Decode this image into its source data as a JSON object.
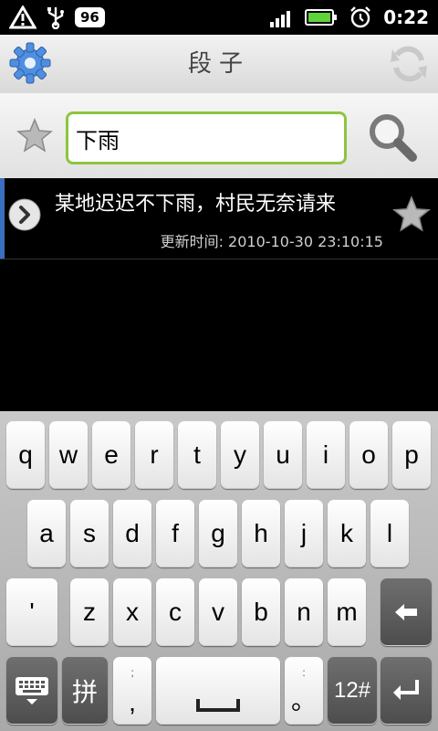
{
  "status_bar": {
    "battery_badge": "96",
    "time": "0:22"
  },
  "title_bar": {
    "title": "段子"
  },
  "search": {
    "value": "下雨",
    "placeholder": ""
  },
  "list": {
    "items": [
      {
        "title": "某地迟迟不下雨，村民无奈请来",
        "updated": "更新时间: 2010-10-30 23:10:15"
      }
    ]
  },
  "keyboard": {
    "row1": [
      "q",
      "w",
      "e",
      "r",
      "t",
      "y",
      "u",
      "i",
      "o",
      "p"
    ],
    "row2": [
      "a",
      "s",
      "d",
      "f",
      "g",
      "h",
      "j",
      "k",
      "l"
    ],
    "row3": [
      "'",
      "z",
      "x",
      "c",
      "v",
      "b",
      "n",
      "m"
    ],
    "bottom": {
      "pinyin": "拼",
      "semicolon_top": ";",
      "comma": ",",
      "colon_top": ":",
      "period": "。",
      "num_sym": "12#"
    }
  },
  "colors": {
    "search_border": "#8cc63f",
    "accent_bar": "#3a6fbf",
    "gear": "#4f8fe0"
  }
}
